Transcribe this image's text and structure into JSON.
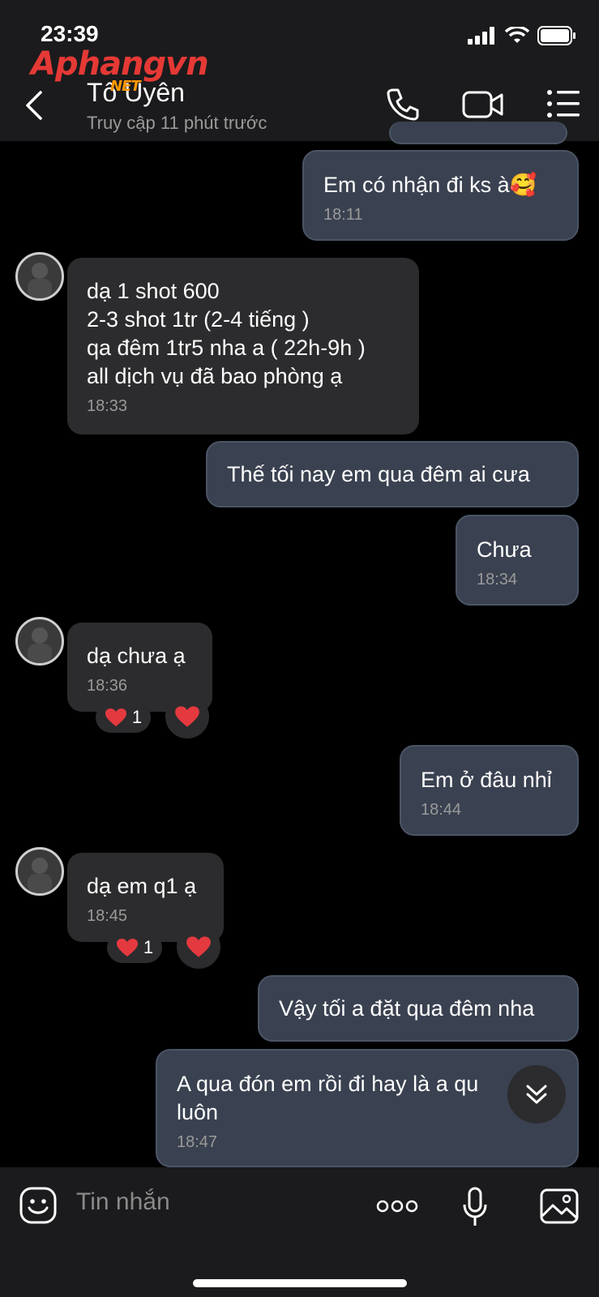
{
  "status": {
    "time": "23:39"
  },
  "watermark": {
    "main": "Aphangvn",
    "sub": "NET"
  },
  "header": {
    "name": "Tố Uyên",
    "presence": "Truy cập 11 phút trước"
  },
  "messages": [
    {
      "text": "Em có nhận đi ks à🥰",
      "time": "18:11"
    },
    {
      "text": "dạ 1 shot 600\n2-3 shot 1tr (2-4 tiếng )\nqa đêm 1tr5 nha a ( 22h-9h )\nall dịch vụ đã bao phòng ạ",
      "time": "18:33"
    },
    {
      "text": "Thế tối nay em qua đêm ai cưa"
    },
    {
      "text": "Chưa",
      "time": "18:34"
    },
    {
      "text": "dạ chưa ạ",
      "time": "18:36",
      "reaction_count": "1"
    },
    {
      "text": "Em ở đâu nhỉ",
      "time": "18:44"
    },
    {
      "text": "dạ em q1 ạ",
      "time": "18:45",
      "reaction_count": "1"
    },
    {
      "text": "Vậy tối a đặt qua đêm nha"
    },
    {
      "text": "A qua đón em rồi đi hay là a qu\nluôn",
      "time": "18:47"
    }
  ],
  "composer": {
    "placeholder": "Tin nhắn"
  },
  "colors": {
    "outgoing": "#3a4150",
    "incoming": "#2c2c2e",
    "heart": "#e53940"
  }
}
